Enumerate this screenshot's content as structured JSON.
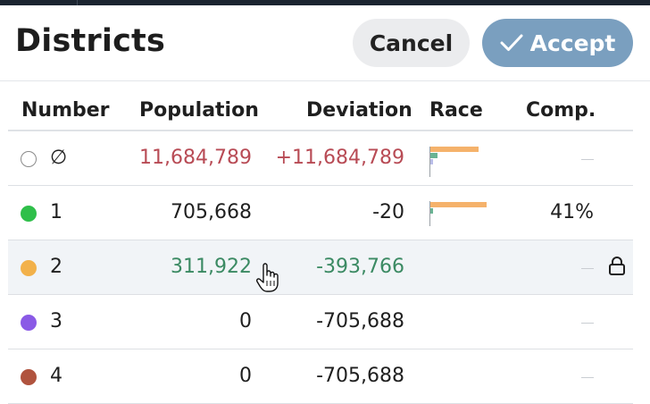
{
  "header": {
    "title": "Districts",
    "cancel_label": "Cancel",
    "accept_label": "Accept"
  },
  "columns": {
    "number": "Number",
    "population": "Population",
    "deviation": "Deviation",
    "race": "Race",
    "comp": "Comp."
  },
  "rows": [
    {
      "number": "∅",
      "population": "11,684,789",
      "deviation": "+11,684,789",
      "comp": "",
      "color": "#ffffff",
      "status": "over"
    },
    {
      "number": "1",
      "population": "705,668",
      "deviation": "-20",
      "comp": "41%",
      "color": "#2fbf4a",
      "status": "normal"
    },
    {
      "number": "2",
      "population": "311,922",
      "deviation": "-393,766",
      "comp": "",
      "color": "#f2b14a",
      "status": "under"
    },
    {
      "number": "3",
      "population": "0",
      "deviation": "-705,688",
      "comp": "",
      "color": "#8a5ae6",
      "status": "normal"
    },
    {
      "number": "4",
      "population": "0",
      "deviation": "-705,688",
      "comp": "",
      "color": "#b0533e",
      "status": "normal"
    }
  ],
  "colors": {
    "accent": "#7a9fbf",
    "over": "#b84b55",
    "under": "#3b8a63",
    "race_primary": "#f5b26b",
    "race_secondary": "#69b393",
    "race_tertiary": "#b9bde8"
  },
  "icons": {
    "accept": "check-icon",
    "lock": "lock-icon",
    "cursor": "hand-pointer-icon"
  }
}
